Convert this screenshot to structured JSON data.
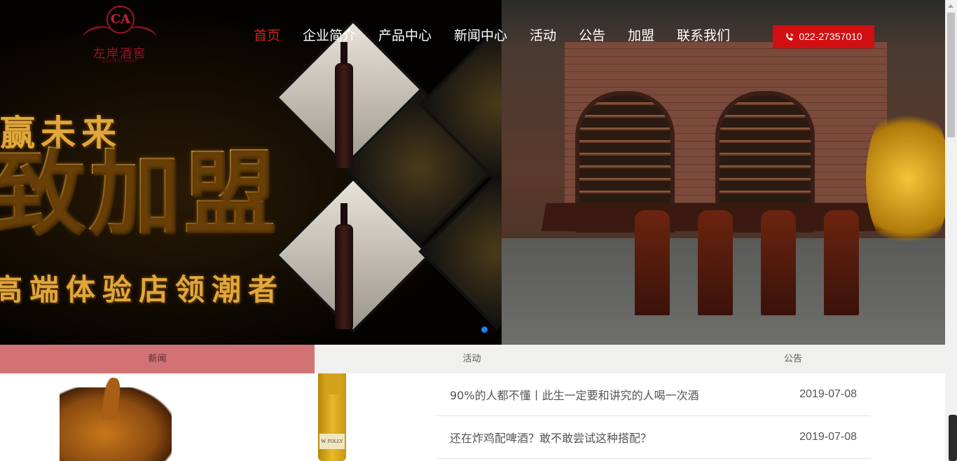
{
  "brand": {
    "name": "左岸酒窖",
    "subtitle": "ZuoAnCellar",
    "monogram": "CA",
    "color": "#9a1428"
  },
  "nav": {
    "items": [
      {
        "label": "首页",
        "active": true
      },
      {
        "label": "企业简介"
      },
      {
        "label": "产品中心"
      },
      {
        "label": "新闻中心"
      },
      {
        "label": "活动"
      },
      {
        "label": "公告"
      },
      {
        "label": "加盟"
      },
      {
        "label": "联系我们"
      }
    ],
    "active_color": "#d42121"
  },
  "contact": {
    "phone": "022-27357010",
    "icon": "phone-icon",
    "bg_color": "#d10f12"
  },
  "banner": {
    "line1": "赢未来",
    "line2": "致加盟",
    "line3": "高端体验店领潮者",
    "slider_dot_color": "#1e7dff"
  },
  "tabs": [
    {
      "label": "新闻",
      "active": true
    },
    {
      "label": "活动"
    },
    {
      "label": "公告"
    }
  ],
  "news": [
    {
      "title": "90%的人都不懂丨此生一定要和讲究的人喝一次酒",
      "date": "2019-07-08"
    },
    {
      "title": "还在炸鸡配啤酒？敢不敢尝试这种搭配？",
      "date": "2019-07-08"
    }
  ],
  "thumb": {
    "label_text": "W. FOLLY"
  }
}
